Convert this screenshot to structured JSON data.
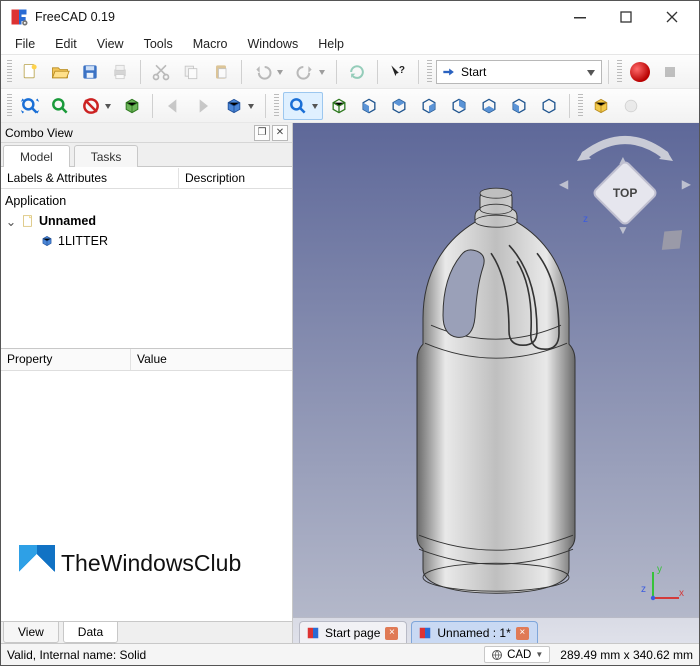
{
  "window": {
    "title": "FreeCAD 0.19"
  },
  "menu": {
    "items": [
      "File",
      "Edit",
      "View",
      "Tools",
      "Macro",
      "Windows",
      "Help"
    ]
  },
  "workbench": {
    "selected": "Start"
  },
  "combo_view": {
    "title": "Combo View",
    "tabs": {
      "model": "Model",
      "tasks": "Tasks"
    },
    "columns": {
      "labels": "Labels & Attributes",
      "description": "Description"
    },
    "app_root": "Application",
    "doc_name": "Unnamed",
    "item_name": "1LITTER",
    "prop_cols": {
      "property": "Property",
      "value": "Value"
    },
    "bottom_tabs": {
      "view": "View",
      "data": "Data"
    }
  },
  "navcube": {
    "face": "TOP"
  },
  "doc_tabs": {
    "start": "Start page",
    "doc": "Unnamed : 1*"
  },
  "status": {
    "msg": "Valid, Internal name: Solid",
    "mode": "CAD",
    "dims": "289.49 mm x 340.62 mm"
  },
  "axes": {
    "y": "y",
    "z": "z",
    "x": "x"
  },
  "watermark": "TheWindowsClub"
}
